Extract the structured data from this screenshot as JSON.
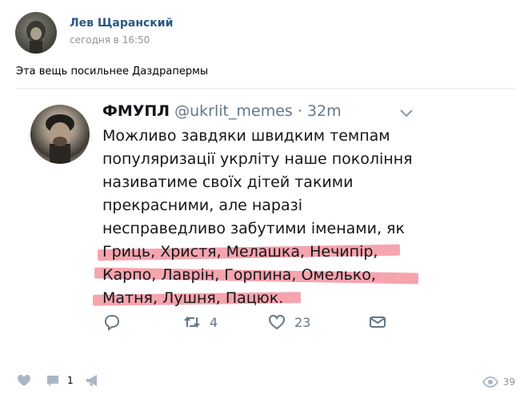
{
  "post": {
    "author": "Лев Щаранский",
    "time": "сегодня в 16:50",
    "text": "Эта вещь посильнее Даздрапермы"
  },
  "tweet": {
    "name": "ФМУПЛ",
    "handle": "@ukrlit_memes",
    "separator": "·",
    "age": "32m",
    "lines": [
      "Можливо завдяки швидким темпам",
      "популяризації укрліту наше покоління",
      "називатиме своїх дітей такими",
      "прекрасними, але наразі",
      "несправедливо забутими іменами, як",
      "Гриць, Христя, Мелашка, Нечипір,",
      "Карпо, Лаврін, Горпина, Омелько,",
      "Матня, Лушня, Пацюк."
    ],
    "retweets": "4",
    "likes": "23",
    "highlight_color": "#ef5a6c"
  },
  "footer": {
    "comments": "1",
    "views": "39",
    "icon_color": "#a8b6c6"
  }
}
